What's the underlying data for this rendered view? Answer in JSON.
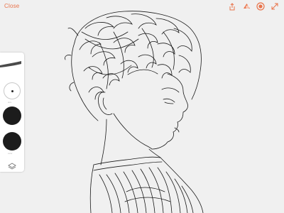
{
  "toolbar": {
    "close_label": "Close",
    "icons": [
      "share-icon",
      "layers-color-icon",
      "settings-icon",
      "expand-icon"
    ],
    "accent_color": "#e9734a"
  },
  "tools": {
    "size_label": "size",
    "swatch_label": "color",
    "swatch_color": "#1c1c1c",
    "layers_icon": "layers-icon"
  }
}
